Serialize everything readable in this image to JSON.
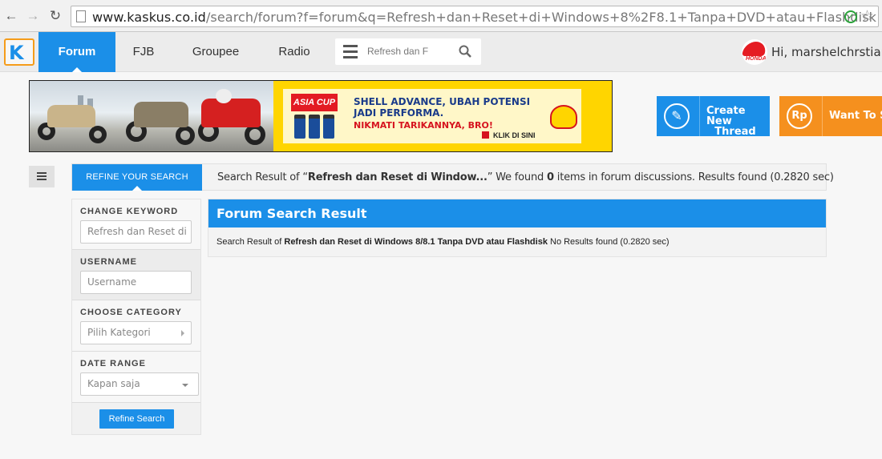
{
  "browser": {
    "url_host": "www.kaskus.co.id",
    "url_path": "/search/forum?f=forum&q=Refresh+dan+Reset+di+Windows+8%2F8.1+Tanpa+DVD+atau+Flashdisk"
  },
  "header": {
    "logo": "K",
    "nav": [
      "Forum",
      "FJB",
      "Groupee",
      "Radio"
    ],
    "search_value": "Refresh dan F",
    "greeting": "Hi, marshelchrstian"
  },
  "banner": {
    "cup_logo": "ASIA CUP",
    "headline_line1": "SHELL ADVANCE, UBAH POTENSI",
    "headline_line2": "JADI PERFORMA.",
    "subline": "NIKMATI TARIKANNYA, BRO!",
    "cta": "KLIK DI SINI"
  },
  "actions": {
    "create_line1": "Create New",
    "create_line2": "Thread",
    "create_icon": "pencil",
    "rp_icon": "Rp",
    "want_label": "Want To Se"
  },
  "refine_tab": "REFINE YOUR SEARCH",
  "summary": {
    "prefix": "Search Result of “",
    "query": "Refresh dan Reset di Window...",
    "middle": "” We found ",
    "count": "0",
    "suffix": " items in forum discussions. Results found (0.2820 sec)"
  },
  "sidebar": {
    "keyword_label": "CHANGE KEYWORD",
    "keyword_value": "Refresh dan Reset di",
    "username_label": "USERNAME",
    "username_placeholder": "Username",
    "category_label": "CHOOSE CATEGORY",
    "category_value": "Pilih Kategori",
    "date_label": "DATE RANGE",
    "date_value": "Kapan saja",
    "refine_button": "Refine Search"
  },
  "result": {
    "title": "Forum Search Result",
    "prefix": "Search Result of ",
    "query": "Refresh dan Reset di Windows 8/8.1 Tanpa DVD atau Flashdisk",
    "suffix": " No Results found (0.2820 sec)"
  },
  "colors": {
    "kaskus_blue": "#1b8fe8",
    "orange": "#f5901e",
    "shell_yellow": "#ffd500"
  }
}
